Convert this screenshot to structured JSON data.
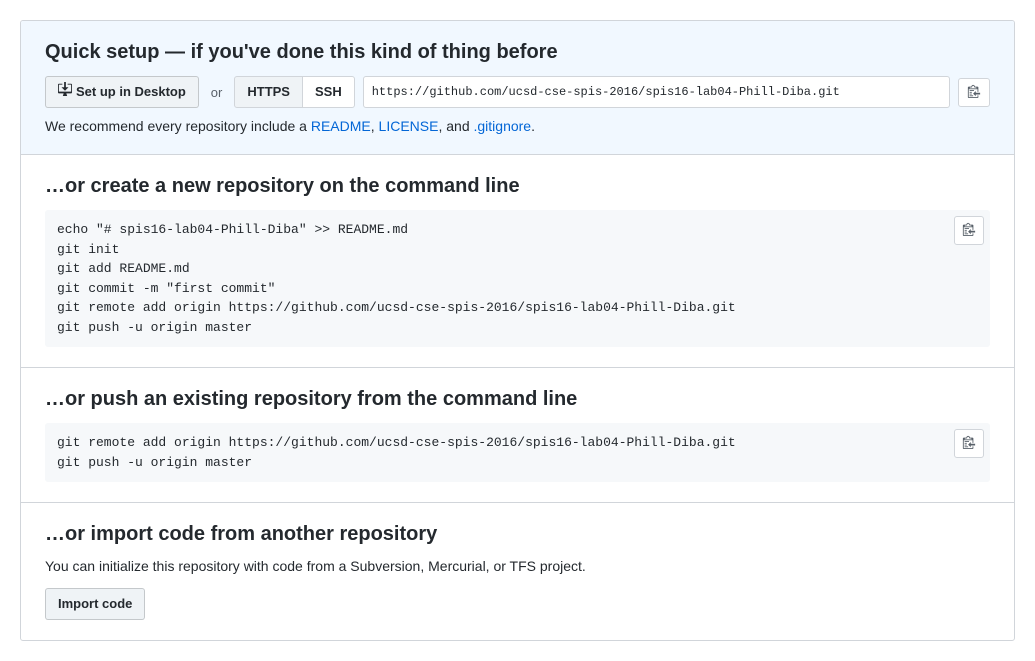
{
  "quickSetup": {
    "heading": "Quick setup — if you've done this kind of thing before",
    "setupDesktopLabel": "Set up in Desktop",
    "orText": "or",
    "protocols": {
      "https": "HTTPS",
      "ssh": "SSH"
    },
    "cloneUrl": "https://github.com/ucsd-cse-spis-2016/spis16-lab04-Phill-Diba.git",
    "recommend": {
      "prefix": "We recommend every repository include a ",
      "readme": "README",
      "sep1": ", ",
      "license": "LICENSE",
      "sep2": ", and ",
      "gitignore": ".gitignore",
      "suffix": "."
    }
  },
  "createRepo": {
    "heading": "…or create a new repository on the command line",
    "code": "echo \"# spis16-lab04-Phill-Diba\" >> README.md\ngit init\ngit add README.md\ngit commit -m \"first commit\"\ngit remote add origin https://github.com/ucsd-cse-spis-2016/spis16-lab04-Phill-Diba.git\ngit push -u origin master"
  },
  "pushRepo": {
    "heading": "…or push an existing repository from the command line",
    "code": "git remote add origin https://github.com/ucsd-cse-spis-2016/spis16-lab04-Phill-Diba.git\ngit push -u origin master"
  },
  "importRepo": {
    "heading": "…or import code from another repository",
    "description": "You can initialize this repository with code from a Subversion, Mercurial, or TFS project.",
    "importButton": "Import code"
  }
}
